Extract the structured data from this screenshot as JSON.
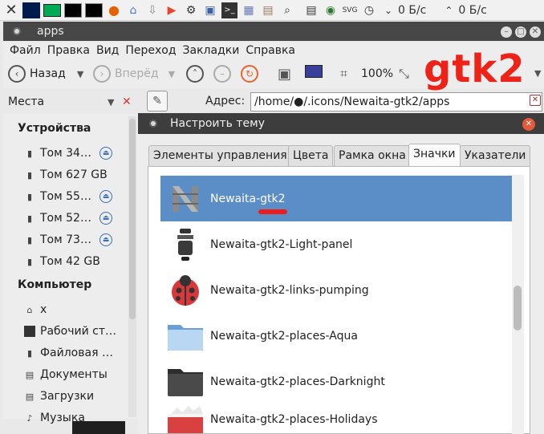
{
  "panel": {
    "net_down": "0 Б/с",
    "net_up": "0 Б/с"
  },
  "window": {
    "title": "apps"
  },
  "menu": [
    "Файл",
    "Правка",
    "Вид",
    "Переход",
    "Закладки",
    "Справка"
  ],
  "toolbar": {
    "back_label": "Назад",
    "forward_label": "Вперёд",
    "zoom_label": "100%"
  },
  "brand_text": "gtk2",
  "location": {
    "places_label": "Места",
    "address_label": "Адрес:",
    "path": "/home/●/.icons/Newaita-gtk2/apps"
  },
  "sidebar": {
    "devices_header": "Устройства",
    "devices": [
      {
        "label": "Том 34…",
        "eject": true
      },
      {
        "label": "Том 627 GB",
        "eject": false
      },
      {
        "label": "Том 55…",
        "eject": true
      },
      {
        "label": "Том 52…",
        "eject": true
      },
      {
        "label": "Том 73…",
        "eject": true
      },
      {
        "label": "Том 42 GB",
        "eject": false
      }
    ],
    "computer_header": "Компьютер",
    "computer": [
      {
        "label": "x"
      },
      {
        "label": "Рабочий ст…"
      },
      {
        "label": "Файловая …"
      },
      {
        "label": "Документы"
      },
      {
        "label": "Загрузки"
      },
      {
        "label": "Музыка"
      }
    ]
  },
  "dialog": {
    "title": "Настроить тему",
    "tabs": [
      "Элементы управления",
      "Цвета",
      "Рамка окна",
      "Значки",
      "Указатели"
    ],
    "active_tab": "Значки",
    "themes": [
      {
        "name": "Newaita-gtk2",
        "selected": true
      },
      {
        "name": "Newaita-gtk2-Light-panel",
        "selected": false
      },
      {
        "name": "Newaita-gtk2-links-pumping",
        "selected": false
      },
      {
        "name": "Newaita-gtk2-places-Aqua",
        "selected": false
      },
      {
        "name": "Newaita-gtk2-places-Darknight",
        "selected": false
      },
      {
        "name": "Newaita-gtk2-places-Holidays",
        "selected": false
      }
    ]
  }
}
